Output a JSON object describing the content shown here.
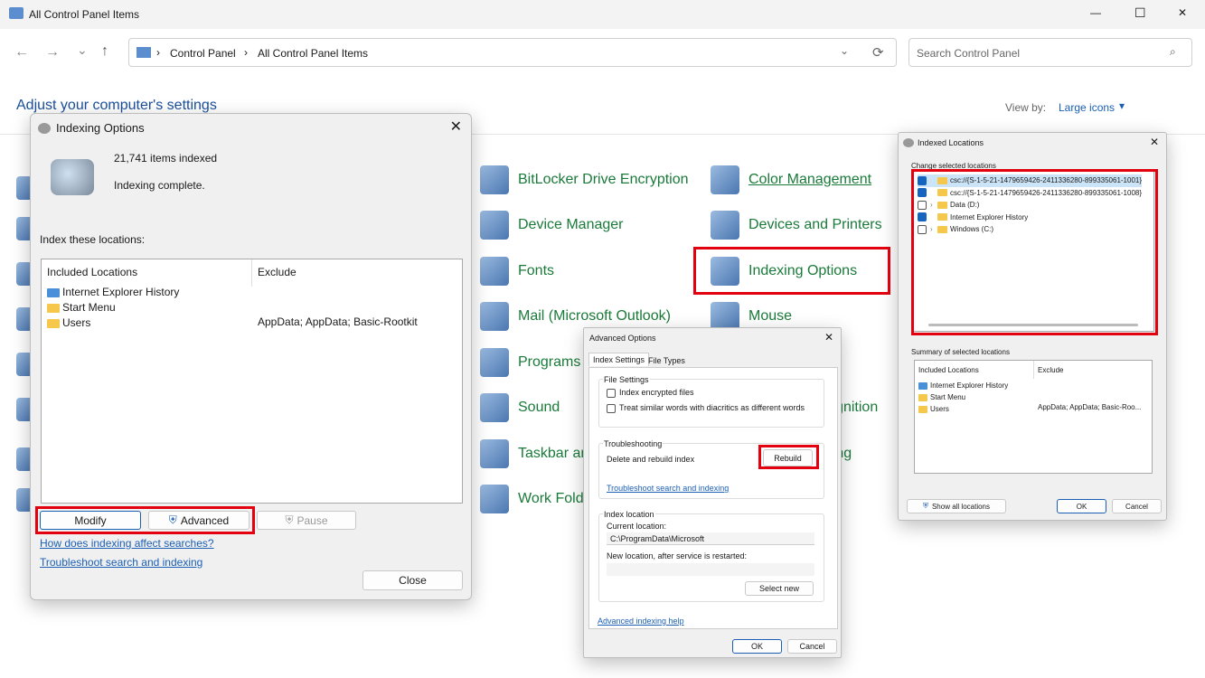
{
  "window": {
    "title": "All Control Panel Items",
    "minimize": "—",
    "maximize": "☐",
    "close": "✕"
  },
  "nav": {
    "back": "←",
    "forward": "→",
    "recent": "⌄",
    "up": "↑",
    "breadcrumb": [
      "Control Panel",
      "All Control Panel Items"
    ],
    "refresh": "⟳",
    "dropdown": "⌄"
  },
  "search": {
    "placeholder": "Search Control Panel"
  },
  "header": {
    "title": "Adjust your computer's settings",
    "view_by_label": "View by:",
    "view_by_value": "Large icons"
  },
  "items_col1": [
    "BitLocker Drive Encryption",
    "Device Manager",
    "Fonts",
    "Mail (Microsoft Outlook)",
    "Programs and Features",
    "Sound",
    "Taskbar and Navigation",
    "Work Folders"
  ],
  "items_col2": [
    "Color Management",
    "Devices and Printers",
    "Indexing Options",
    "Mouse",
    "",
    "Speech Recognition",
    "Troubleshooting",
    ""
  ],
  "indexing": {
    "title": "Indexing Options",
    "count": "21,741 items indexed",
    "status": "Indexing complete.",
    "index_label": "Index these locations:",
    "col_included": "Included Locations",
    "col_exclude": "Exclude",
    "rows": [
      {
        "name": "Internet Explorer History",
        "exclude": ""
      },
      {
        "name": "Start Menu",
        "exclude": ""
      },
      {
        "name": "Users",
        "exclude": "AppData; AppData; Basic-Rootkit"
      }
    ],
    "modify": "Modify",
    "advanced": "Advanced",
    "pause": "Pause",
    "link1": "How does indexing affect searches?",
    "link2": "Troubleshoot search and indexing",
    "close": "Close"
  },
  "advanced": {
    "title": "Advanced Options",
    "tab1": "Index Settings",
    "tab2": "File Types",
    "file_settings": "File Settings",
    "cb1": "Index encrypted files",
    "cb2": "Treat similar words with diacritics as different words",
    "troubleshooting": "Troubleshooting",
    "rebuild_label": "Delete and rebuild index",
    "rebuild": "Rebuild",
    "ts_link": "Troubleshoot search and indexing",
    "index_location": "Index location",
    "current_label": "Current location:",
    "current_value": "C:\\ProgramData\\Microsoft",
    "new_label": "New location, after service is restarted:",
    "select_new": "Select new",
    "help": "Advanced indexing help",
    "ok": "OK",
    "cancel": "Cancel"
  },
  "locations": {
    "title": "Indexed Locations",
    "change_label": "Change selected locations",
    "tree": [
      {
        "label": "csc://{S-1-5-21-1479659426-2411336280-899335061-1001}",
        "checked": true
      },
      {
        "label": "csc://{S-1-5-21-1479659426-2411336280-899335061-1008}",
        "checked": true
      },
      {
        "label": "Data (D:)",
        "checked": false
      },
      {
        "label": "Internet Explorer History",
        "checked": true
      },
      {
        "label": "Windows (C:)",
        "checked": false
      }
    ],
    "summary_label": "Summary of selected locations",
    "col_included": "Included Locations",
    "col_exclude": "Exclude",
    "summary": [
      {
        "name": "Internet Explorer History",
        "exclude": ""
      },
      {
        "name": "Start Menu",
        "exclude": ""
      },
      {
        "name": "Users",
        "exclude": "AppData; AppData; Basic-Roo..."
      }
    ],
    "show_all": "Show all locations",
    "ok": "OK",
    "cancel": "Cancel"
  },
  "colors": {
    "highlight": "#e3000f",
    "link": "#1a5fb4",
    "item_text": "#1a7a3a"
  }
}
